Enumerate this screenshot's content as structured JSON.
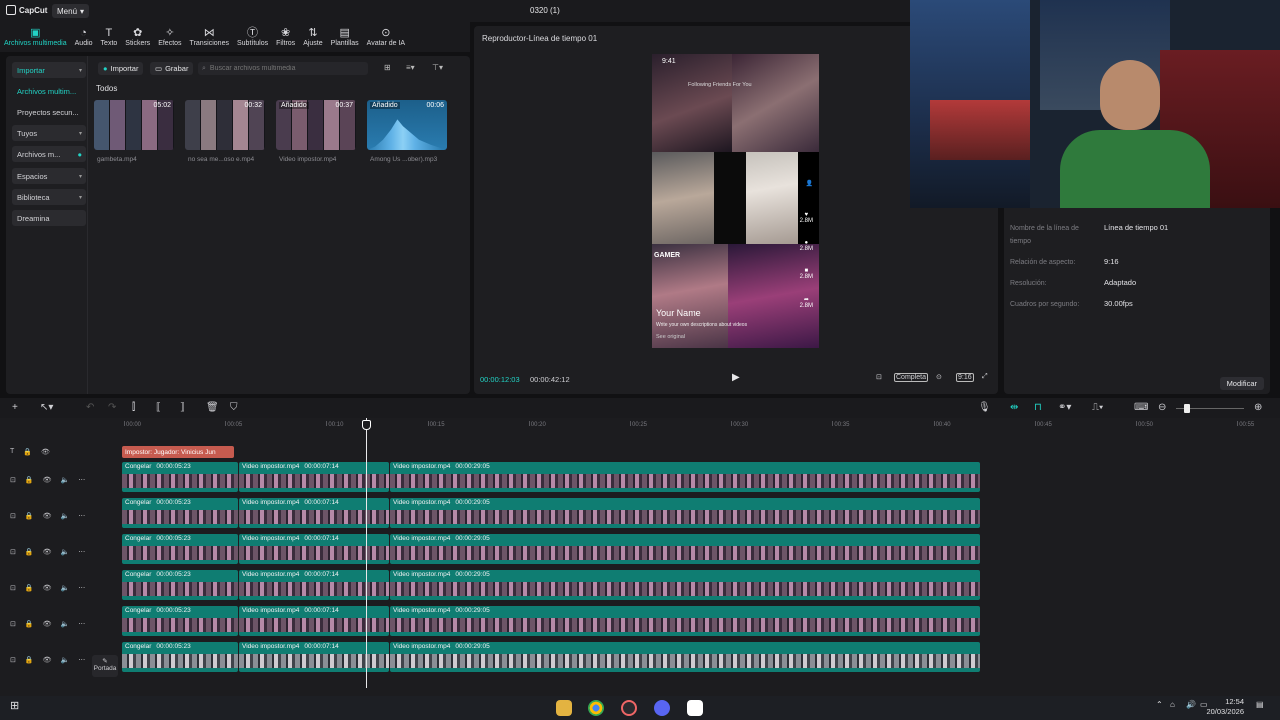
{
  "app": {
    "logo_text": "CapCut",
    "menu_label": "Menú",
    "project_title": "0320 (1)"
  },
  "toolbar": {
    "items": [
      {
        "label": "Archivos multimedia",
        "icon": "media-icon",
        "active": true
      },
      {
        "label": "Audio",
        "icon": "audio-icon"
      },
      {
        "label": "Texto",
        "icon": "text-icon"
      },
      {
        "label": "Stickers",
        "icon": "sticker-icon"
      },
      {
        "label": "Efectos",
        "icon": "effects-icon"
      },
      {
        "label": "Transiciones",
        "icon": "transition-icon"
      },
      {
        "label": "Subtítulos",
        "icon": "subtitle-icon"
      },
      {
        "label": "Filtros",
        "icon": "filter-icon"
      },
      {
        "label": "Ajuste",
        "icon": "adjust-icon"
      },
      {
        "label": "Plantillas",
        "icon": "template-icon"
      },
      {
        "label": "Avatar de IA",
        "icon": "avatar-icon"
      }
    ]
  },
  "media": {
    "sidebar": [
      "Importar",
      "Archivos multim...",
      "Proyectos secun...",
      "Tuyos",
      "Archivos m...",
      "Espacios",
      "Biblioteca",
      "Dreamina"
    ],
    "import_label": "Importar",
    "record_label": "Grabar",
    "search_placeholder": "Buscar archivos multimedia",
    "section_label": "Todos",
    "items": [
      {
        "name": "gambeta.mp4",
        "duration": "05:02",
        "tag": ""
      },
      {
        "name": "no sea me...oso e.mp4",
        "duration": "00:32",
        "tag": ""
      },
      {
        "name": "Video impostor.mp4",
        "duration": "00:37",
        "tag": "Añadido"
      },
      {
        "name": "Among Us ...ober).mp3",
        "duration": "00:06",
        "tag": "Añadido"
      }
    ]
  },
  "player": {
    "title": "Reproductor-Línea de tiempo 01",
    "current_time": "00:00:12:03",
    "total_time": "00:00:42:12",
    "quality_label": "Completa",
    "ratio_label": "9:16",
    "phone": {
      "clock": "9:41",
      "tabs": "Following   Friends   For You",
      "username": "Your Name",
      "caption": "Write your own descriptions about videos",
      "see_original": "See original",
      "counts": [
        "2.8M",
        "2.8M",
        "2.8M",
        "2.8M"
      ],
      "overlay_text": "GAMER"
    }
  },
  "details": {
    "rows": [
      {
        "label": "Nombre de la línea de tiempo",
        "value": "Línea de tiempo 01"
      },
      {
        "label": "Relación de aspecto:",
        "value": "9:16"
      },
      {
        "label": "Resolución:",
        "value": "Adaptado"
      },
      {
        "label": "Cuadros por segundo:",
        "value": "30.00fps"
      }
    ],
    "modify_label": "Modificar"
  },
  "timeline": {
    "ruler": [
      "00:00",
      "00:05",
      "00:10",
      "00:15",
      "00:20",
      "00:25",
      "00:30",
      "00:35",
      "00:40",
      "00:45",
      "00:50",
      "00:55"
    ],
    "text_clip": "Impostor: Jugador: Vinicius Jun",
    "clips": [
      {
        "label": "Congelar",
        "duration": "00:00:05:23"
      },
      {
        "label": "Video impostor.mp4",
        "duration": "00:00:07:14"
      },
      {
        "label": "Video impostor.mp4",
        "duration": "00:00:29:05"
      }
    ],
    "cover_label": "Portada"
  },
  "taskbar": {
    "time": "12:54",
    "date": "20/03/2026"
  }
}
